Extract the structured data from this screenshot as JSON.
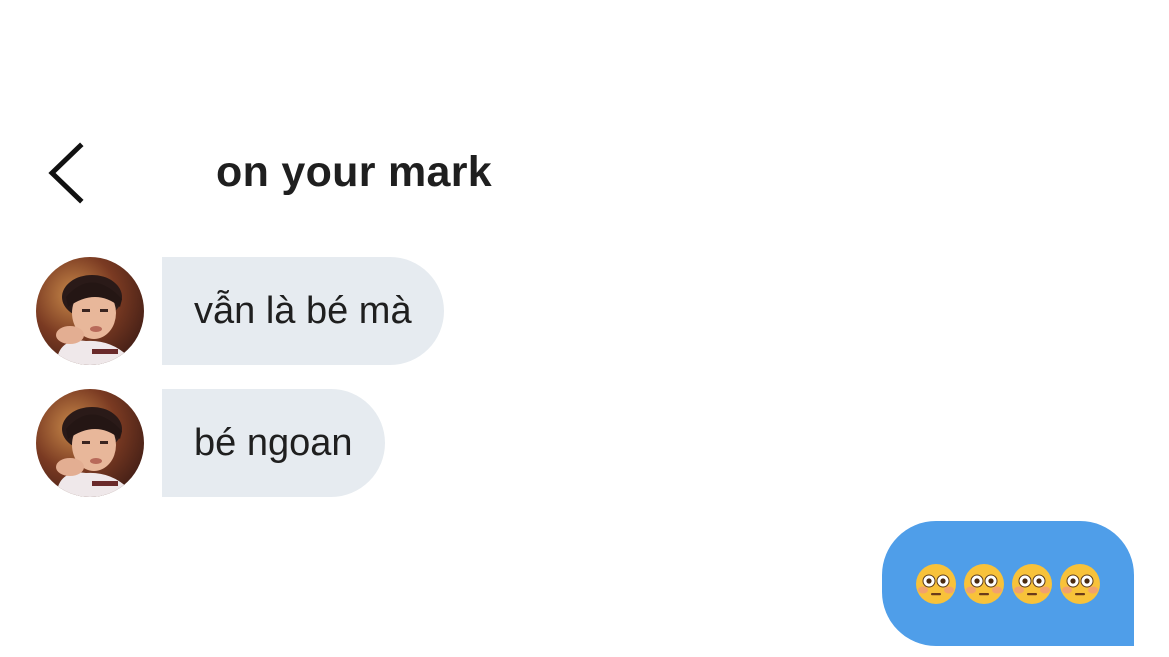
{
  "header": {
    "back_icon": "chevron-left-icon",
    "title": "on your mark"
  },
  "messages": [
    {
      "direction": "incoming",
      "text": "vẫn là bé mà",
      "avatar": "user-photo"
    },
    {
      "direction": "incoming",
      "text": "bé ngoan",
      "avatar": "user-photo"
    },
    {
      "direction": "outgoing",
      "content": "4 flushed-face emojis",
      "emoji_icon": "flushed-face-emoji",
      "emoji_count": 4
    }
  ],
  "colors": {
    "background": "#ffffff",
    "incoming_bubble": "#e6ebf0",
    "outgoing_bubble": "#4f9ee9",
    "text": "#1f1f1f"
  }
}
